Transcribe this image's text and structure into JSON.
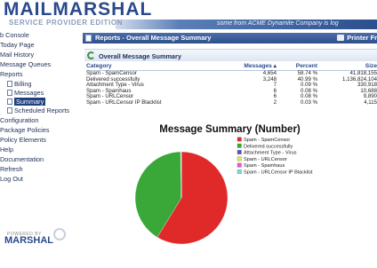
{
  "banner": {
    "logo_main": "MAILMARSHAL",
    "logo_sub": "SERVICE PROVIDER EDITION",
    "message": "some from ACME Dynamite Company is log"
  },
  "sidebar": {
    "items": [
      {
        "label": "b Console",
        "level": 0,
        "active": false
      },
      {
        "label": "Today Page",
        "level": 0,
        "active": false
      },
      {
        "label": "Mail History",
        "level": 0,
        "active": false
      },
      {
        "label": "Message Queues",
        "level": 0,
        "active": false
      },
      {
        "label": "Reports",
        "level": 0,
        "active": false
      },
      {
        "label": "Billing",
        "level": 1,
        "active": false
      },
      {
        "label": "Messages",
        "level": 1,
        "active": false
      },
      {
        "label": "Summary",
        "level": 1,
        "active": true
      },
      {
        "label": "Scheduled Reports",
        "level": 1,
        "active": false
      },
      {
        "label": "Configuration",
        "level": 0,
        "active": false
      },
      {
        "label": "Package Policies",
        "level": 0,
        "active": false
      },
      {
        "label": "Policy Elements",
        "level": 0,
        "active": false
      },
      {
        "label": "Help",
        "level": 0,
        "active": false
      },
      {
        "label": "Documentation",
        "level": 0,
        "active": false
      },
      {
        "label": "Refresh",
        "level": 0,
        "active": false
      },
      {
        "label": "Log Out",
        "level": 0,
        "active": false
      }
    ],
    "powered_by": "POWERED BY",
    "powered_logo": "MARSHAL"
  },
  "content": {
    "title": "Reports - Overall Message Summary",
    "printer_label": "Printer Fr",
    "section_title": "Overall Message Summary",
    "table": {
      "headers": [
        "Category",
        "Messages ▴",
        "Percent",
        "Size"
      ],
      "rows": [
        [
          "Spam - SpamCensor",
          "4,654",
          "58.74 %",
          "41,818,155"
        ],
        [
          "Delivered successfully",
          "3,248",
          "40.99 %",
          "1,136,824,104"
        ],
        [
          "Attachment Type - Virus",
          "7",
          "0.09 %",
          "330,918"
        ],
        [
          "Spam - Spamhaus",
          "6",
          "0.08 %",
          "10,688"
        ],
        [
          "Spam - URLCensor",
          "6",
          "0.08 %",
          "9,890"
        ],
        [
          "Spam - URLCensor IP Blacklist",
          "2",
          "0.03 %",
          "4,115"
        ]
      ]
    }
  },
  "chart_data": {
    "type": "pie",
    "title": "Message Summary (Number)",
    "legend_position": "right",
    "slices": [
      {
        "label": "Spam - SpamCensor",
        "value": 4654,
        "color": "#e02a2a"
      },
      {
        "label": "Delivered successfully",
        "value": 3248,
        "color": "#39a839"
      },
      {
        "label": "Attachment Type - Virus",
        "value": 7,
        "color": "#5a50b4"
      },
      {
        "label": "Spam - URLCensor",
        "value": 6,
        "color": "#e6e64a"
      },
      {
        "label": "Spam - Spamhaus",
        "value": 6,
        "color": "#e05ad0"
      },
      {
        "label": "Spam - URLCensor IP Blacklist",
        "value": 2,
        "color": "#7fd8e0"
      }
    ]
  },
  "colors": {
    "brand_dark": "#2a4a8c",
    "nav_active": "#1f3f7e",
    "title_bar": "#2d4f8d"
  }
}
